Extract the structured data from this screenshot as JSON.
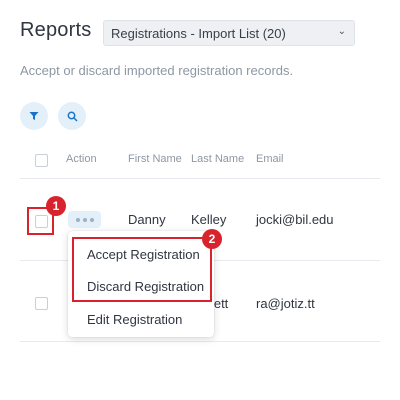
{
  "header": {
    "title": "Reports",
    "select_value": "Registrations - Import List (20)",
    "subtitle": "Accept or discard imported registration records."
  },
  "toolbar": {
    "filter_icon": "filter-icon",
    "search_icon": "search-icon"
  },
  "table": {
    "columns": [
      "Action",
      "First Name",
      "Last Name",
      "Email"
    ],
    "rows": [
      {
        "first_name": "Danny",
        "last_name": "Kelley",
        "email": "jocki@bil.edu"
      },
      {
        "first_name": "",
        "last_name": "...ett",
        "email": "ra@jotiz.tt"
      }
    ]
  },
  "action_menu": {
    "items": [
      "Accept Registration",
      "Discard Registration",
      "Edit Registration"
    ]
  },
  "annotations": {
    "badge_1": "1",
    "badge_2": "2",
    "highlight_color": "#d9232c"
  },
  "colors": {
    "accent": "#1a73c9",
    "accent_bg": "#e3f0fa"
  }
}
